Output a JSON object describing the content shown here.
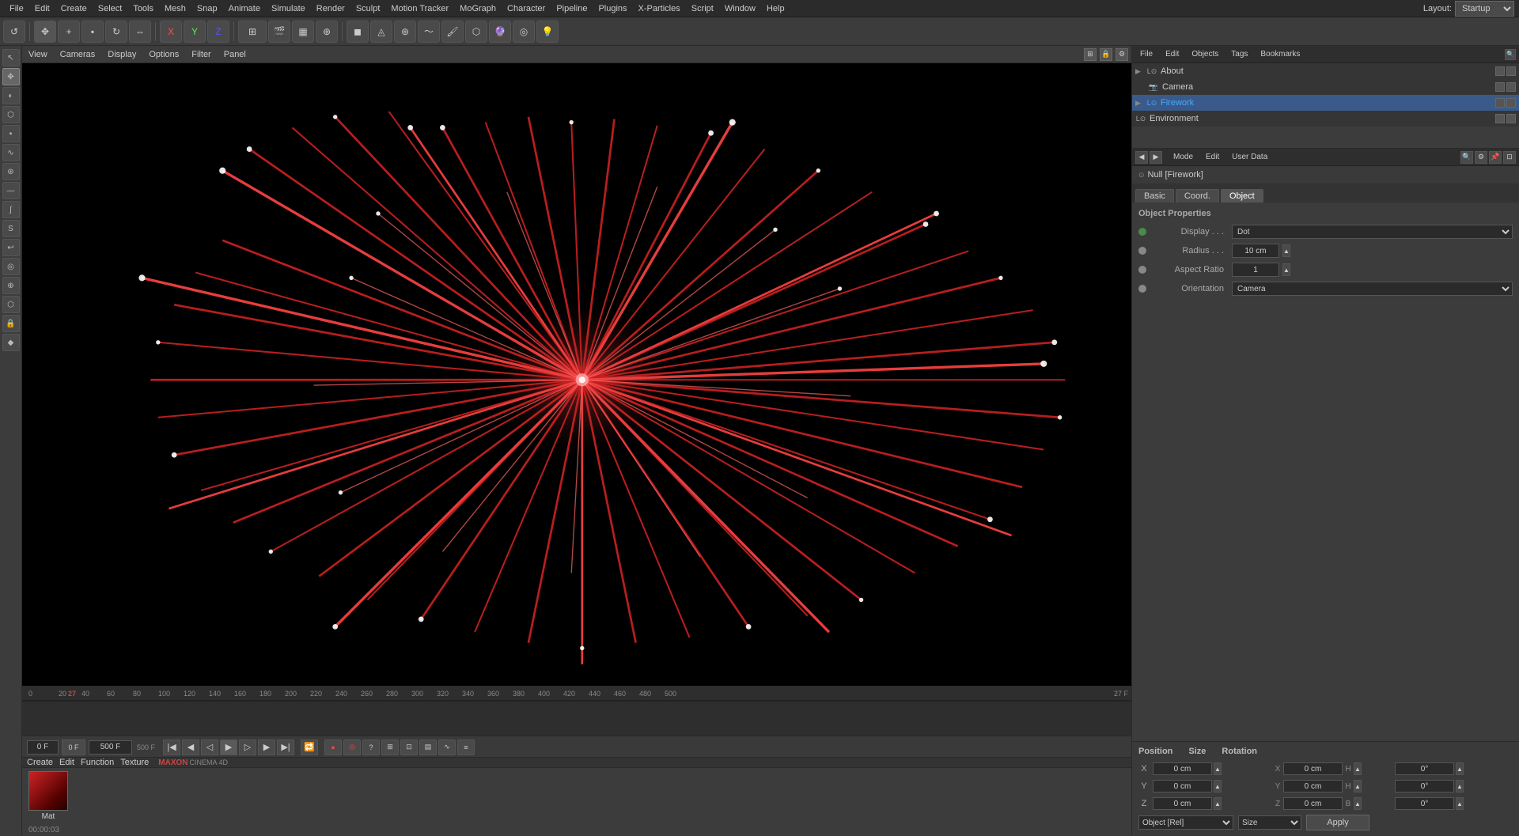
{
  "app": {
    "title": "MAXON CINEMA 4D",
    "layout": "Startup"
  },
  "top_menu": {
    "items": [
      "File",
      "Edit",
      "Create",
      "Select",
      "Tools",
      "Mesh",
      "Snap",
      "Animate",
      "Simulate",
      "Render",
      "Sculpt",
      "Motion Tracker",
      "MoGraph",
      "Character",
      "Pipeline",
      "Plugins",
      "X-Particles",
      "Script",
      "Window",
      "Help"
    ]
  },
  "toolbar": {
    "layout_label": "Layout:",
    "layout_value": "Startup"
  },
  "viewport": {
    "menus": [
      "View",
      "Cameras",
      "Display",
      "Options",
      "Filter",
      "Panel"
    ]
  },
  "object_manager": {
    "menus": [
      "File",
      "Edit",
      "Objects",
      "Tags",
      "Bookmarks"
    ],
    "objects": [
      {
        "name": "About",
        "type": "null",
        "color": "#888888",
        "indent": 0,
        "selected": false,
        "vis": true,
        "lock": false
      },
      {
        "name": "Camera",
        "type": "camera",
        "color": "#888888",
        "indent": 1,
        "selected": false,
        "vis": true,
        "lock": false
      },
      {
        "name": "Firework",
        "type": "null",
        "color": "#44aaff",
        "indent": 0,
        "selected": true,
        "vis": true,
        "lock": false
      },
      {
        "name": "Environment",
        "type": "null",
        "color": "#888888",
        "indent": 0,
        "selected": false,
        "vis": true,
        "lock": false
      }
    ]
  },
  "attribute_manager": {
    "header_menus": [
      "Mode",
      "Edit",
      "User Data"
    ],
    "current_object": "Null [Firework]",
    "tabs": [
      "Basic",
      "Coord.",
      "Object"
    ],
    "active_tab": "Object",
    "section_title": "Object Properties",
    "fields": {
      "display_label": "Display . . .",
      "display_value": "Dot",
      "radius_label": "Radius . . .",
      "radius_value": "10 cm",
      "aspect_ratio_label": "Aspect Ratio",
      "aspect_ratio_value": "1",
      "orientation_label": "Orientation",
      "orientation_value": "Camera"
    }
  },
  "timeline": {
    "start_frame": "0 F",
    "current_frame": "0 F",
    "end_frame": "500 F",
    "frame_rate": "27 F",
    "ruler_marks": [
      "0",
      "20",
      "27",
      "40",
      "60",
      "80",
      "100",
      "120",
      "140",
      "160",
      "180",
      "200",
      "220",
      "240",
      "260",
      "280",
      "300",
      "320",
      "340",
      "360",
      "380",
      "400",
      "420",
      "440",
      "460",
      "480",
      "500"
    ]
  },
  "material_editor": {
    "menus": [
      "Create",
      "Edit",
      "Function",
      "Texture"
    ],
    "material_name": "Mat"
  },
  "coord_panel": {
    "headers": [
      "Position",
      "Size",
      "Rotation"
    ],
    "position": {
      "x": "0 cm",
      "y": "0 cm",
      "z": "0 cm"
    },
    "size": {
      "x": "0 cm",
      "y": "0 cm",
      "z": "0 cm"
    },
    "size_labels": [
      "H",
      "H",
      "B"
    ],
    "rotation": {
      "x": "0°",
      "y": "0°",
      "z": "0°"
    },
    "obj_mode": "Object [Rel]",
    "size_mode": "Size",
    "apply_label": "Apply"
  },
  "status_bar": {
    "time": "00:00:03"
  },
  "icons": {
    "undo": "↺",
    "move": "✥",
    "add": "+",
    "cube": "▪",
    "rotate": "↻",
    "x": "×",
    "y": "Y",
    "z": "Z",
    "snap": "⊞",
    "camera": "📷",
    "light": "💡",
    "play": "▶",
    "stop": "■",
    "prev": "◀◀",
    "next": "▶▶",
    "record": "●",
    "key": "◆",
    "arrow_left": "◀",
    "arrow_right": "▶",
    "chevron": "▼"
  }
}
